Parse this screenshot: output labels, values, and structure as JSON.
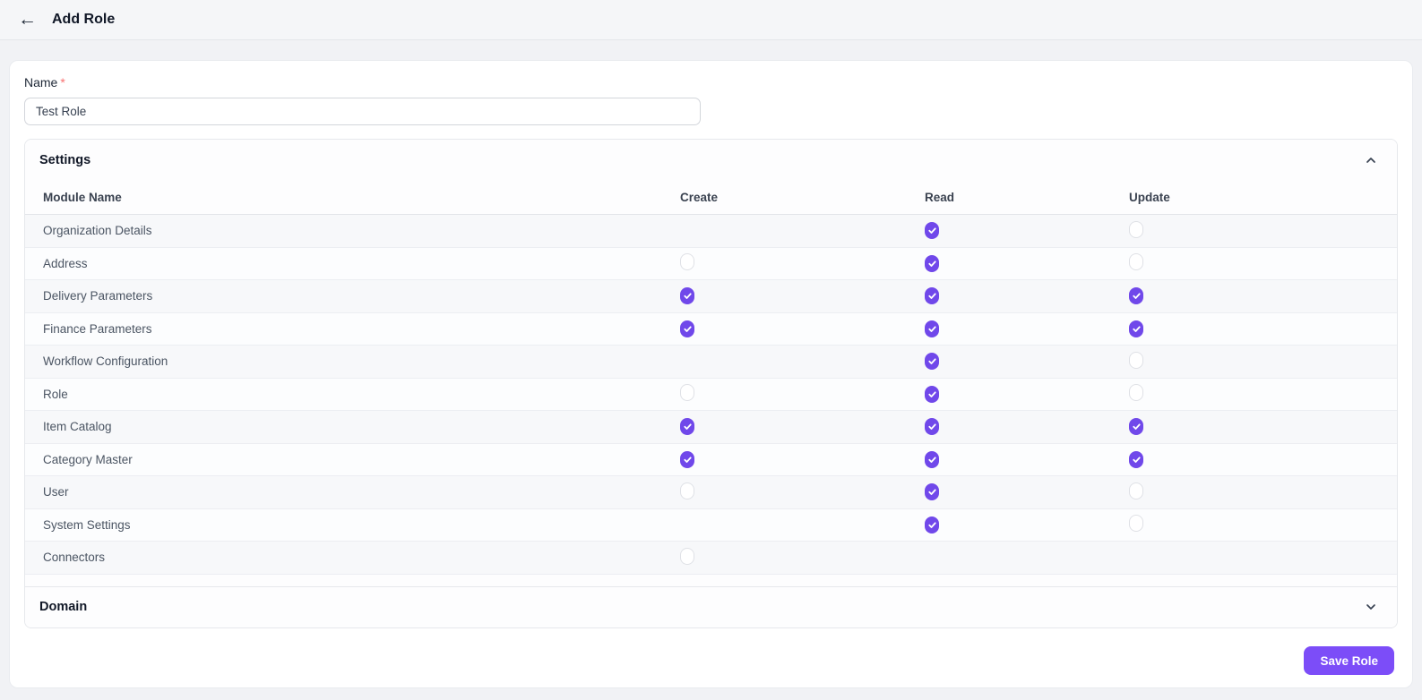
{
  "header": {
    "back_icon": "arrow-left",
    "title": "Add Role"
  },
  "form": {
    "name_label": "Name",
    "required_marker": "*",
    "name_value": "Test Role"
  },
  "sections": [
    {
      "id": "settings",
      "title": "Settings",
      "expanded": true
    },
    {
      "id": "domain",
      "title": "Domain",
      "expanded": false
    }
  ],
  "permissions_table": {
    "columns": [
      "Module Name",
      "Create",
      "Read",
      "Update"
    ],
    "rows": [
      {
        "module": "Organization Details",
        "create": "none",
        "read": "checked",
        "update": "unchecked"
      },
      {
        "module": "Address",
        "create": "unchecked",
        "read": "checked",
        "update": "unchecked"
      },
      {
        "module": "Delivery Parameters",
        "create": "checked",
        "read": "checked",
        "update": "checked"
      },
      {
        "module": "Finance Parameters",
        "create": "checked",
        "read": "checked",
        "update": "checked"
      },
      {
        "module": "Workflow Configuration",
        "create": "none",
        "read": "checked",
        "update": "unchecked"
      },
      {
        "module": "Role",
        "create": "unchecked",
        "read": "checked",
        "update": "unchecked"
      },
      {
        "module": "Item Catalog",
        "create": "checked",
        "read": "checked",
        "update": "checked"
      },
      {
        "module": "Category Master",
        "create": "checked",
        "read": "checked",
        "update": "checked"
      },
      {
        "module": "User",
        "create": "unchecked",
        "read": "checked",
        "update": "unchecked"
      },
      {
        "module": "System Settings",
        "create": "none",
        "read": "checked",
        "update": "unchecked"
      },
      {
        "module": "Connectors",
        "create": "unchecked",
        "read": "none",
        "update": "none"
      }
    ]
  },
  "actions": {
    "save_label": "Save Role"
  },
  "colors": {
    "accent_purple": "#7C4DF8",
    "checkbox_purple": "#7048EA",
    "required_red": "#F87171"
  }
}
